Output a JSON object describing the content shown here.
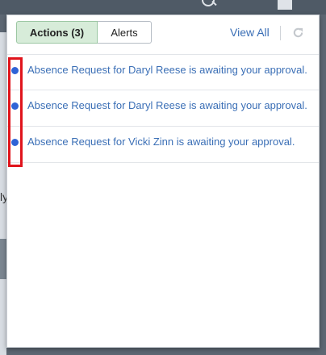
{
  "tabs": [
    {
      "label": "Actions (3)",
      "active": true
    },
    {
      "label": "Alerts",
      "active": false
    }
  ],
  "view_all_label": "View All",
  "icons": {
    "search": "search-icon",
    "menu": "menu-icon",
    "refresh": "refresh-icon"
  },
  "notifications": [
    {
      "text": "Absence Request for Daryl Reese is awaiting your approval.",
      "unread": true
    },
    {
      "text": "Absence Request for Daryl Reese is awaiting your approval.",
      "unread": true
    },
    {
      "text": "Absence Request for Vicki Zinn is awaiting your approval.",
      "unread": true
    }
  ],
  "background": {
    "partial_text": "ly"
  },
  "colors": {
    "link": "#3b6fb6",
    "unread_dot": "#2f63d6",
    "active_tab": "#d7ecd9",
    "highlight": "#e0141c"
  }
}
